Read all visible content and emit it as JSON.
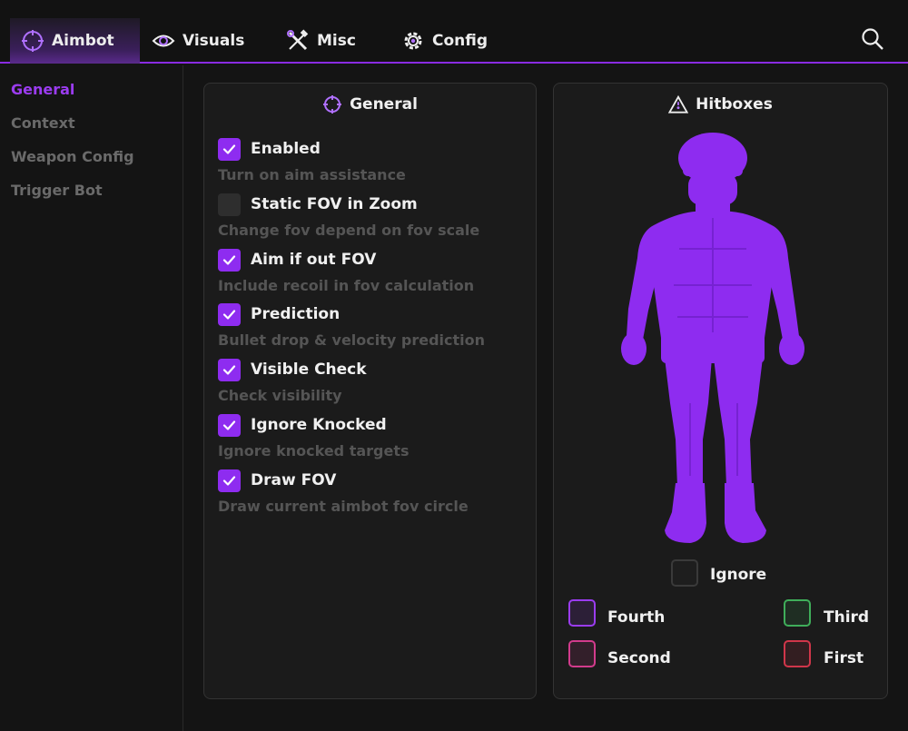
{
  "nav": {
    "tabs": [
      {
        "label": "Aimbot",
        "icon": "crosshair-icon"
      },
      {
        "label": "Visuals",
        "icon": "eye-icon"
      },
      {
        "label": "Misc",
        "icon": "tools-icon"
      },
      {
        "label": "Config",
        "icon": "gear-icon"
      }
    ],
    "active_tab": "Aimbot",
    "accent": "#8a2be2"
  },
  "sidebar": {
    "items": [
      {
        "label": "General"
      },
      {
        "label": "Context"
      },
      {
        "label": "Weapon Config"
      },
      {
        "label": "Trigger Bot"
      }
    ],
    "active": "General"
  },
  "general": {
    "title": "General",
    "options": [
      {
        "label": "Enabled",
        "desc": "Turn on aim assistance",
        "checked": true
      },
      {
        "label": "Static FOV in Zoom",
        "desc": "Change fov depend on fov scale",
        "checked": false
      },
      {
        "label": "Aim if out FOV",
        "desc": "Include recoil in fov calculation",
        "checked": true
      },
      {
        "label": "Prediction",
        "desc": "Bullet drop & velocity prediction",
        "checked": true
      },
      {
        "label": "Visible Check",
        "desc": "Check visibility",
        "checked": true
      },
      {
        "label": "Ignore Knocked",
        "desc": "Ignore knocked targets",
        "checked": true
      },
      {
        "label": "Draw FOV",
        "desc": "Draw current aimbot fov circle",
        "checked": true
      }
    ]
  },
  "hitboxes": {
    "title": "Hitboxes",
    "ignore_label": "Ignore",
    "priorities": [
      {
        "label": "Fourth",
        "color": "#9b3cf0"
      },
      {
        "label": "Third",
        "color": "#3fae5a"
      },
      {
        "label": "Second",
        "color": "#d23b8c"
      },
      {
        "label": "First",
        "color": "#d0364a"
      }
    ],
    "figure_color": "#8e2cf0"
  }
}
